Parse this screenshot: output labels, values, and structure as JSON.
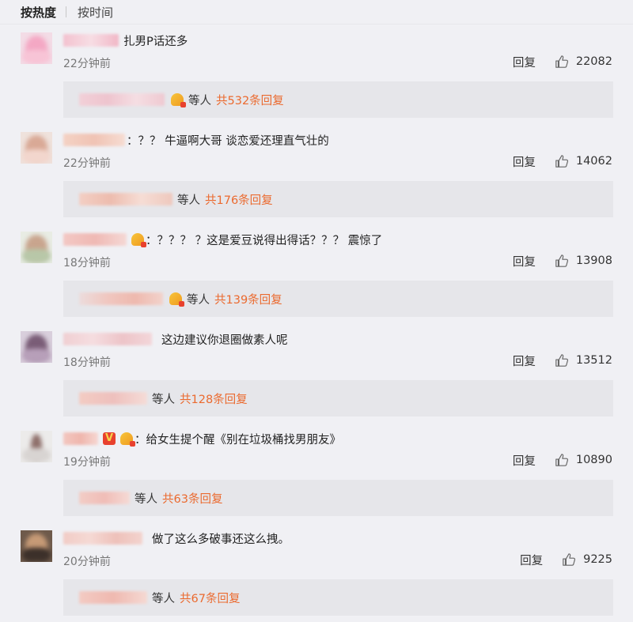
{
  "tabs": {
    "hot": "按热度",
    "time": "按时间"
  },
  "reply_label": "回复",
  "others_label": "等人",
  "comments": [
    {
      "text": "扎男P话还多",
      "colon": "",
      "time": "22分钟前",
      "likes": "22082",
      "reply_total": "共532条回复"
    },
    {
      "text": "？？ 牛逼啊大哥 谈恋爱还理直气壮的",
      "colon": "：",
      "time": "22分钟前",
      "likes": "14062",
      "reply_total": "共176条回复"
    },
    {
      "text": "？？？ ？这是爱豆说得出得话？？？ 震惊了",
      "colon": "：",
      "time": "18分钟前",
      "likes": "13908",
      "reply_total": "共139条回复"
    },
    {
      "text": "这边建议你退圈做素人呢",
      "colon": "",
      "time": "18分钟前",
      "likes": "13512",
      "reply_total": "共128条回复"
    },
    {
      "text": "给女生提个醒《别在垃圾桶找男朋友》",
      "colon": "：",
      "time": "19分钟前",
      "likes": "10890",
      "reply_total": "共63条回复"
    },
    {
      "text": "做了这么多破事还这么拽。",
      "colon": "",
      "time": "20分钟前",
      "likes": "9225",
      "reply_total": "共67条回复"
    }
  ],
  "colors": {
    "accent": "#eb6a2f",
    "background": "#f0f0f4",
    "reply_box": "#e6e6ea"
  }
}
